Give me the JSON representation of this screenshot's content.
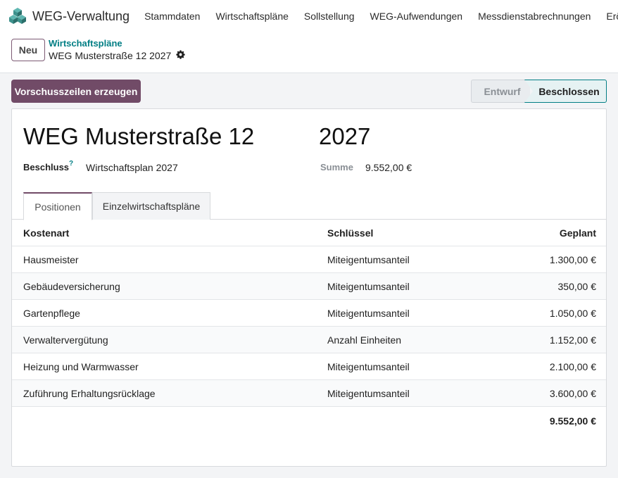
{
  "app": {
    "name": "WEG-Verwaltung",
    "logo_icon": "cubes-logo-icon",
    "accent_color": "#714b67",
    "link_color": "#017e84"
  },
  "menu": [
    {
      "label": "Stammdaten"
    },
    {
      "label": "Wirtschaftspläne"
    },
    {
      "label": "Sollstellung"
    },
    {
      "label": "WEG-Aufwendungen"
    },
    {
      "label": "Messdienstabrechnungen"
    },
    {
      "label": "Eröffn"
    }
  ],
  "control": {
    "new_label": "Neu",
    "breadcrumb_parent": "Wirtschaftspläne",
    "breadcrumb_current": "WEG Musterstraße 12 2027",
    "settings_icon": "gear-icon"
  },
  "actions": {
    "primary_label": "Vorschusszeilen erzeugen"
  },
  "status": {
    "draft_label": "Entwurf",
    "done_label": "Beschlossen",
    "current": "Beschlossen"
  },
  "record": {
    "name": "WEG Musterstraße 12",
    "year": "2027",
    "beschluss_label": "Beschluss",
    "beschluss_help": "?",
    "beschluss_value": "Wirtschaftsplan 2027",
    "summe_label": "Summe",
    "summe_value": "9.552,00 €"
  },
  "tabs": [
    {
      "label": "Positionen",
      "active": true
    },
    {
      "label": "Einzelwirtschaftspläne",
      "active": false
    }
  ],
  "table": {
    "headers": [
      "Kostenart",
      "Schlüssel",
      "Geplant"
    ],
    "rows": [
      [
        "Hausmeister",
        "Miteigentumsanteil",
        "1.300,00 €"
      ],
      [
        "Gebäudeversicherung",
        "Miteigentumsanteil",
        "350,00 €"
      ],
      [
        "Gartenpflege",
        "Miteigentumsanteil",
        "1.050,00 €"
      ],
      [
        "Verwaltervergütung",
        "Anzahl Einheiten",
        "1.152,00 €"
      ],
      [
        "Heizung und Warmwasser",
        "Miteigentumsanteil",
        "2.100,00 €"
      ],
      [
        "Zuführung Erhaltungsrücklage",
        "Miteigentumsanteil",
        "3.600,00 €"
      ]
    ],
    "total": "9.552,00 €"
  }
}
